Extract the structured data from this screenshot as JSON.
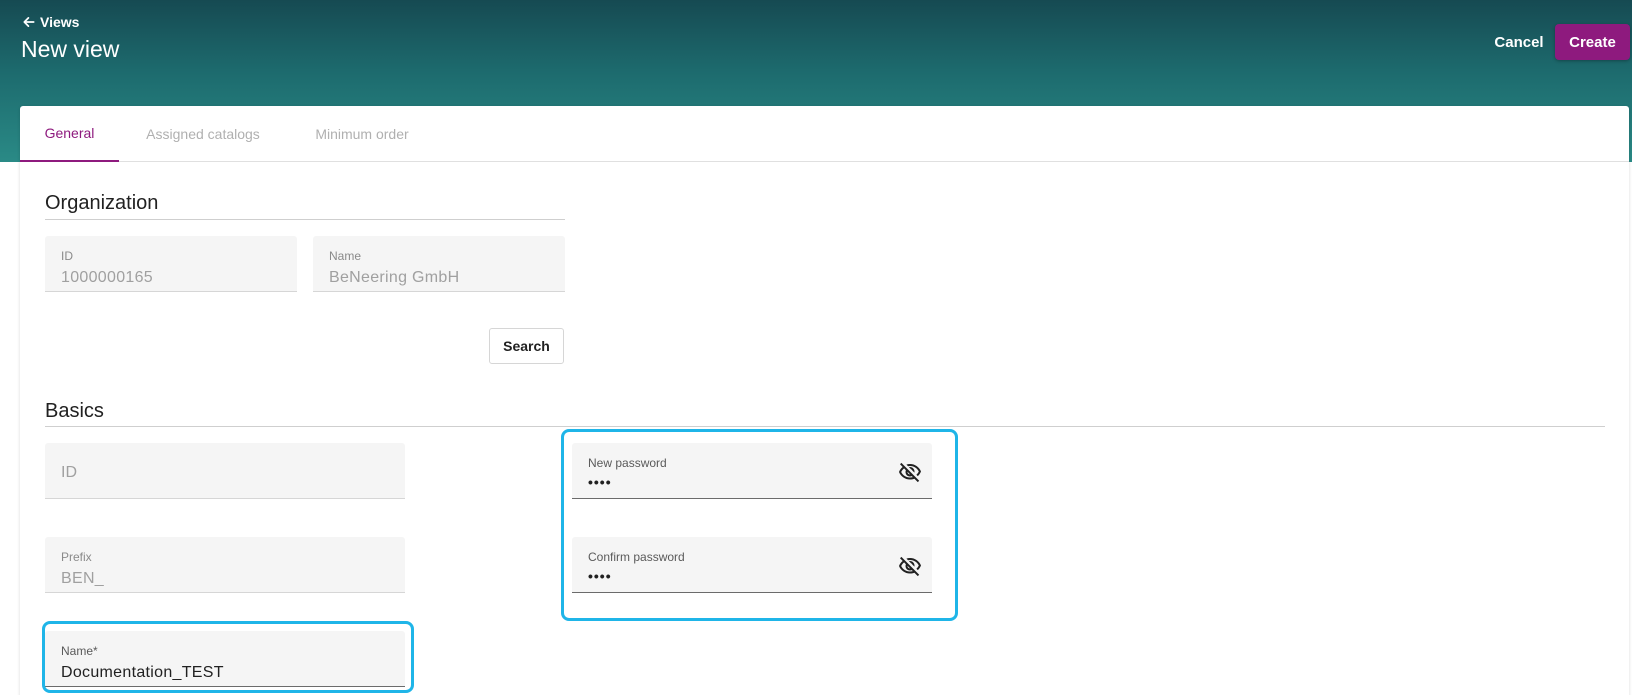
{
  "header": {
    "back_label": "Views",
    "title": "New view",
    "cancel_label": "Cancel",
    "create_label": "Create"
  },
  "tabs": [
    {
      "label": "General",
      "active": true
    },
    {
      "label": "Assigned catalogs",
      "active": false
    },
    {
      "label": "Minimum order",
      "active": false
    }
  ],
  "organization": {
    "title": "Organization",
    "id_label": "ID",
    "id_value": "1000000165",
    "name_label": "Name",
    "name_value": "BeNeering GmbH",
    "search_label": "Search"
  },
  "basics": {
    "title": "Basics",
    "id_placeholder": "ID",
    "prefix_label": "Prefix",
    "prefix_value": "BEN_",
    "name_label": "Name*",
    "name_value": "Documentation_TEST",
    "new_password_label": "New password",
    "new_password_value": "••••",
    "confirm_password_label": "Confirm password",
    "confirm_password_value": "••••"
  },
  "colors": {
    "accent": "#8e1a7e",
    "header_dark": "#164a52",
    "header_light": "#2a8a86",
    "highlight": "#1fb5e8"
  },
  "icons": {
    "back": "arrow-left-icon",
    "password_toggle": "eye-off-icon"
  }
}
